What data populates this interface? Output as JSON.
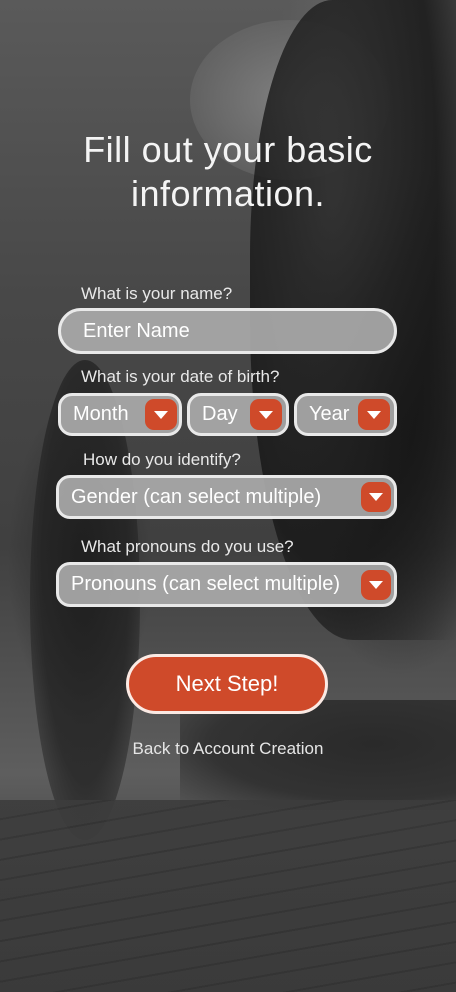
{
  "header": {
    "title": "Fill out your basic\ninformation."
  },
  "form": {
    "name": {
      "label": "What is your name?",
      "placeholder": "Enter Name"
    },
    "dob": {
      "label": "What is your date of birth?",
      "month": "Month",
      "day": "Day",
      "year": "Year"
    },
    "gender": {
      "label": "How do you identify?",
      "value": "Gender (can select multiple)"
    },
    "pronouns": {
      "label": "What pronouns do you use?",
      "value": "Pronouns (can select multiple)"
    }
  },
  "actions": {
    "next_label": "Next Step!",
    "back_label": "Back to Account Creation"
  },
  "colors": {
    "accent": "#cf4a2a",
    "field_bg": "#aaaaaa",
    "field_border": "#e9e9e9"
  },
  "icons": {
    "dropdown": "chevron-down-icon"
  }
}
